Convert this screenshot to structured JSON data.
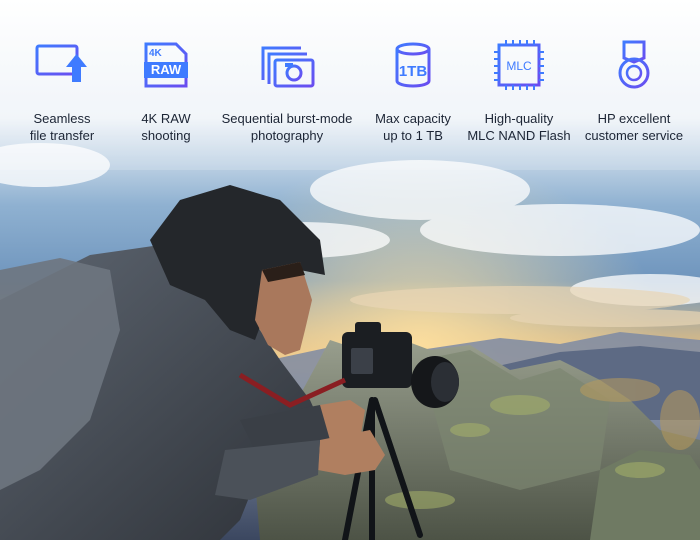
{
  "features": [
    {
      "icon": "monitor-upload-icon",
      "line1": "Seamless",
      "line2": "file transfer"
    },
    {
      "icon": "sd-card-4k-raw-icon",
      "line1": "4K RAW",
      "line2": "shooting",
      "badge_top": "4K",
      "badge_main": "RAW"
    },
    {
      "icon": "burst-photo-icon",
      "line1": "Sequential burst-mode",
      "line2": "photography"
    },
    {
      "icon": "database-1tb-icon",
      "line1": "Max capacity",
      "line2": "up to 1 TB",
      "badge": "1TB"
    },
    {
      "icon": "mlc-chip-icon",
      "line1": "High-quality",
      "line2": "MLC NAND Flash",
      "badge": "MLC"
    },
    {
      "icon": "medal-icon",
      "line1": "HP excellent",
      "line2": "customer service"
    }
  ],
  "colors": {
    "icon_gradient_start": "#3f7bff",
    "icon_gradient_end": "#6a4cf0",
    "text": "#1c2535"
  }
}
